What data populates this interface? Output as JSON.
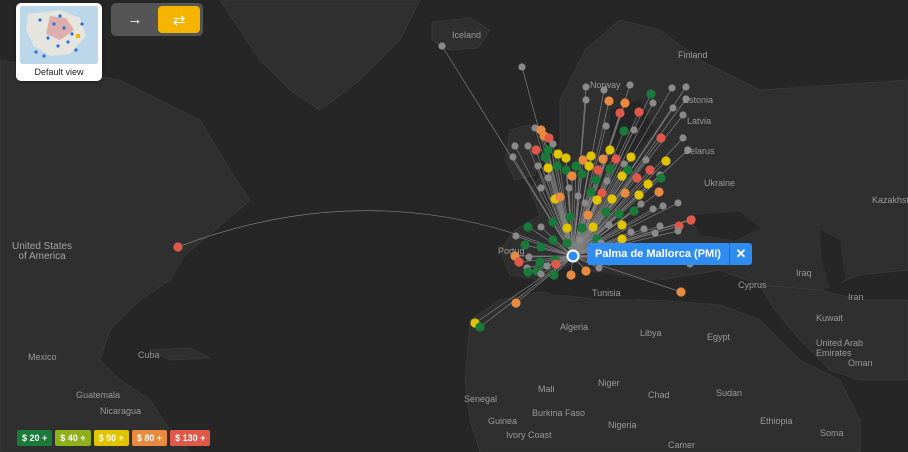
{
  "default_view": {
    "label": "Default view"
  },
  "toggle": {
    "one_way_icon": "arrow-right-icon",
    "round_trip_icon": "swap-arrows-icon",
    "selected": "round_trip"
  },
  "popup": {
    "label": "Palma de Mallorca (PMI)",
    "close_icon": "close-icon"
  },
  "legend": [
    {
      "label": "$ 20 +",
      "color": "#1a7a3a"
    },
    {
      "label": "$ 40 +",
      "color": "#8fb01a"
    },
    {
      "label": "$ 50 +",
      "color": "#e1c400"
    },
    {
      "label": "$ 80 +",
      "color": "#e88a40"
    },
    {
      "label": "$ 130 +",
      "color": "#e0584a"
    }
  ],
  "map_labels": {
    "iceland": "Iceland",
    "finland": "Finland",
    "norway": "Norway",
    "estonia": "Estonia",
    "latvia": "Latvia",
    "belarus": "Belarus",
    "ukraine": "Ukraine",
    "kazakhstan": "Kazakhst",
    "usa": "United States\nof America",
    "mexico": "Mexico",
    "cuba": "Cuba",
    "guatemala": "Guatemala",
    "nicaragua": "Nicaragua",
    "portugal": "Portug",
    "tunisia": "Tunisia",
    "algeria": "Algeria",
    "libya": "Libya",
    "egypt": "Egypt",
    "cyprus": "Cyprus",
    "iraq": "Iraq",
    "iran": "Iran",
    "kuwait": "Kuwait",
    "uae": "United Arab\nEmirates",
    "oman": "Oman",
    "mali": "Mali",
    "niger": "Niger",
    "chad": "Chad",
    "sudan": "Sudan",
    "ethiopia": "Ethiopia",
    "nigeria": "Nigeria",
    "burkina": "Burkina Faso",
    "ivory": "Ivory Coast",
    "guinea": "Guinea",
    "somalia": "Soma",
    "senegal": "Senegal",
    "cameroon": "Camer"
  },
  "colors": {
    "background": "#262626",
    "route_line": "#9a9a9a",
    "origin": "#2f8cf0"
  }
}
